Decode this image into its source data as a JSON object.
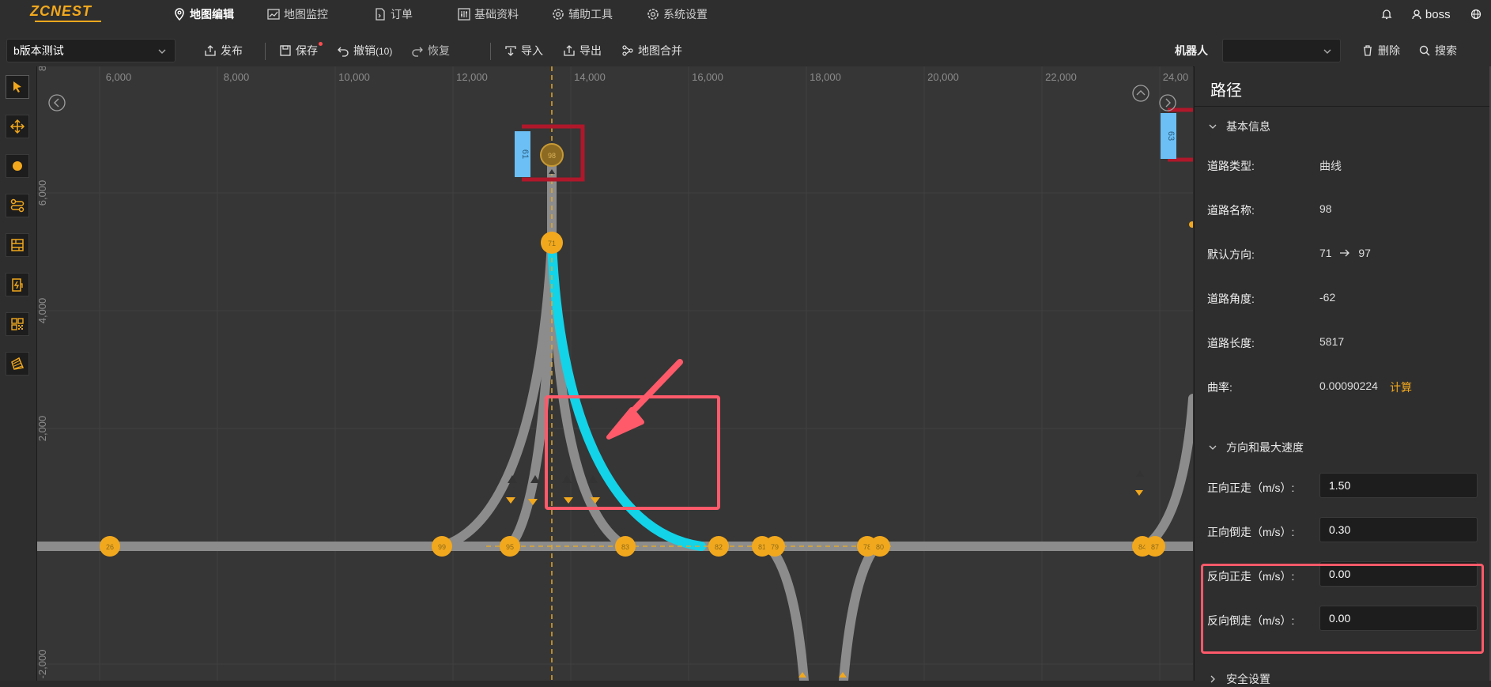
{
  "app": {
    "logo": "ZCNEST",
    "nav": [
      {
        "label": "地图编辑",
        "icon": "location-pin-icon",
        "active": true
      },
      {
        "label": "地图监控",
        "icon": "chart-line-icon",
        "active": false
      },
      {
        "label": "订单",
        "icon": "document-icon",
        "active": false
      },
      {
        "label": "基础资料",
        "icon": "sliders-icon",
        "active": false
      },
      {
        "label": "辅助工具",
        "icon": "gear-icon",
        "active": false
      },
      {
        "label": "系统设置",
        "icon": "gear-icon",
        "active": false
      }
    ],
    "user": "boss",
    "language": "中"
  },
  "toolbar": {
    "map_version": "b版本测试",
    "publish": "发布",
    "save": "保存",
    "undo": "撤销",
    "undo_count": "(10)",
    "redo": "恢复",
    "import": "导入",
    "export": "导出",
    "merge": "地图合并",
    "robot_label": "机器人",
    "robot_value": "",
    "delete": "删除",
    "search": "搜索"
  },
  "map": {
    "x_ticks": [
      "6,000",
      "8,000",
      "10,000",
      "12,000",
      "14,000",
      "16,000",
      "18,000",
      "20,000",
      "22,000",
      "24,00"
    ],
    "y_ticks": [
      "8",
      "6,000",
      "4,000",
      "2,000",
      "-2,000"
    ],
    "stations": [
      "61",
      "63"
    ],
    "nodes": [
      "26",
      "99",
      "95",
      "83",
      "82",
      "81",
      "79",
      "78",
      "80",
      "84",
      "87",
      "98",
      "71"
    ]
  },
  "panel": {
    "title": "路径",
    "basic_section": "基本信息",
    "road_type_label": "道路类型:",
    "road_type": "曲线",
    "road_name_label": "道路名称:",
    "road_name": "98",
    "default_dir_label": "默认方向:",
    "dir_from": "71",
    "dir_to": "97",
    "road_angle_label": "道路角度:",
    "road_angle": "-62",
    "road_length_label": "道路长度:",
    "road_length": "5817",
    "curvature_label": "曲率:",
    "curvature": "0.00090224",
    "calc": "计算",
    "speed_section": "方向和最大速度",
    "fwd_fwd_label": "正向正走（m/s）:",
    "fwd_fwd": "1.50",
    "fwd_back_label": "正向倒走（m/s）:",
    "fwd_back": "0.30",
    "rev_fwd_label": "反向正走（m/s）:",
    "rev_fwd": "0.00",
    "rev_back_label": "反向倒走（m/s）:",
    "rev_back": "0.00",
    "safety_section": "安全设置"
  },
  "colors": {
    "accent": "#f2a81d",
    "selected_path": "#12d3e8",
    "path": "#8c8c8c",
    "highlight": "#ff5a6a",
    "station_red": "#b0172a",
    "station_blue": "#6bbff5"
  }
}
